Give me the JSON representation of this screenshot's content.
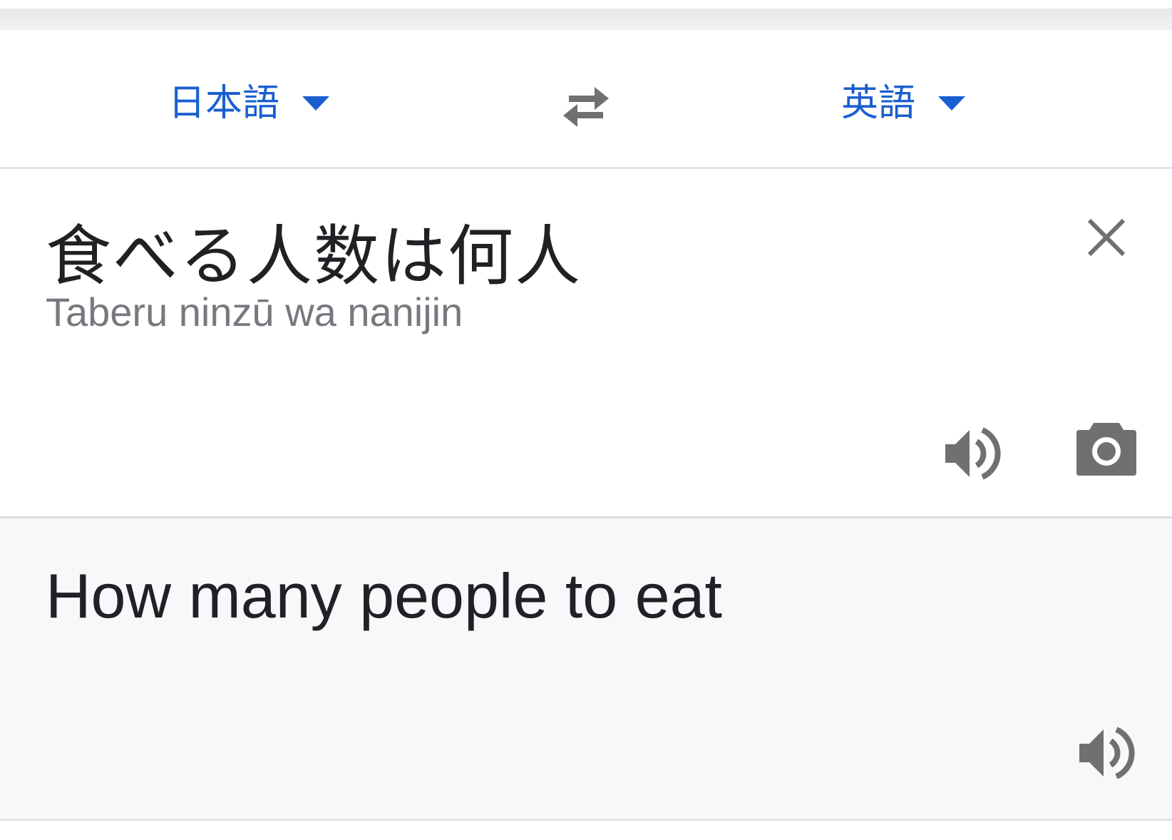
{
  "language_bar": {
    "source_language": "日本語",
    "target_language": "英語"
  },
  "input": {
    "text": "食べる人数は何人",
    "romanization": "Taberu ninzū wa nanijin"
  },
  "output": {
    "translation": "How many people to eat"
  },
  "icons": {
    "swap": "swap-languages-icon",
    "clear": "close-icon",
    "source_speaker": "speaker-icon",
    "camera": "camera-icon",
    "target_speaker": "speaker-icon",
    "dropdown": "chevron-down-icon"
  },
  "colors": {
    "accent": "#1a5fd0",
    "icon_gray": "#707070",
    "text_primary": "#202124",
    "text_secondary": "#76797e",
    "output_background": "#f7f8fa"
  }
}
